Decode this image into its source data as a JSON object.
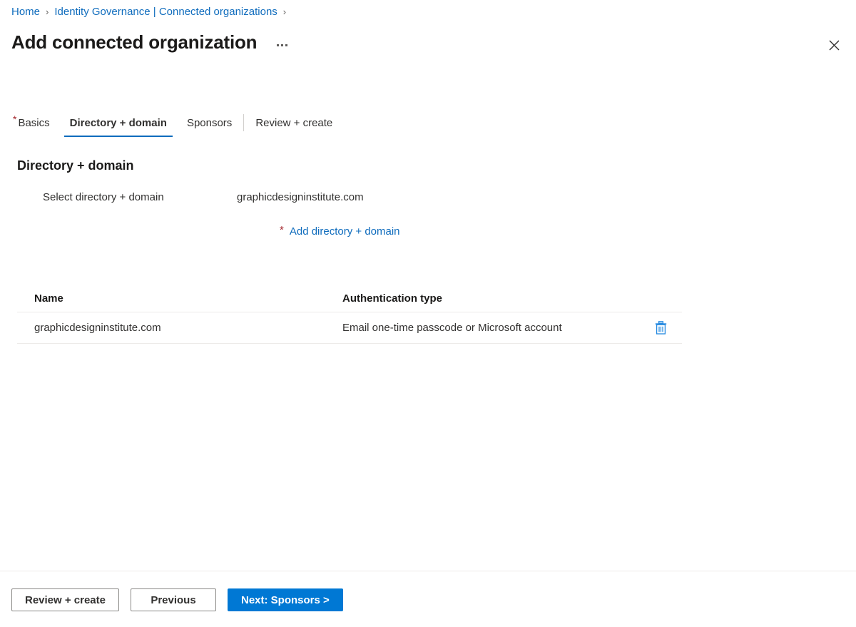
{
  "breadcrumb": {
    "items": [
      {
        "label": "Home"
      },
      {
        "label": "Identity Governance | Connected organizations"
      }
    ],
    "separator": "›"
  },
  "header": {
    "title": "Add connected organization",
    "more_menu_name": "more-commands",
    "close_icon": "close-icon"
  },
  "tabs": [
    {
      "label": "Basics",
      "required": "*",
      "active": false
    },
    {
      "label": "Directory + domain",
      "required": "",
      "active": true
    },
    {
      "label": "Sponsors",
      "required": "",
      "active": false
    },
    {
      "label": "Review + create",
      "required": "",
      "active": false
    }
  ],
  "section": {
    "heading": "Directory + domain",
    "field_label": "Select directory + domain",
    "field_value": "graphicdesigninstitute.com",
    "add_link_required": "*",
    "add_link_label": "Add directory + domain"
  },
  "grid": {
    "columns": [
      "Name",
      "Authentication type"
    ],
    "rows": [
      {
        "name": "graphicdesigninstitute.com",
        "auth_type": "Email one-time passcode or Microsoft account",
        "delete_icon": "trash-icon"
      }
    ]
  },
  "footer": {
    "review_create_label": "Review + create",
    "previous_label": "Previous",
    "next_label": "Next: Sponsors >"
  },
  "colors": {
    "link": "#0f6cbd",
    "primary": "#0078d4",
    "required": "#a4262c",
    "icon_blue": "#2288e0",
    "border": "#edebe9"
  }
}
